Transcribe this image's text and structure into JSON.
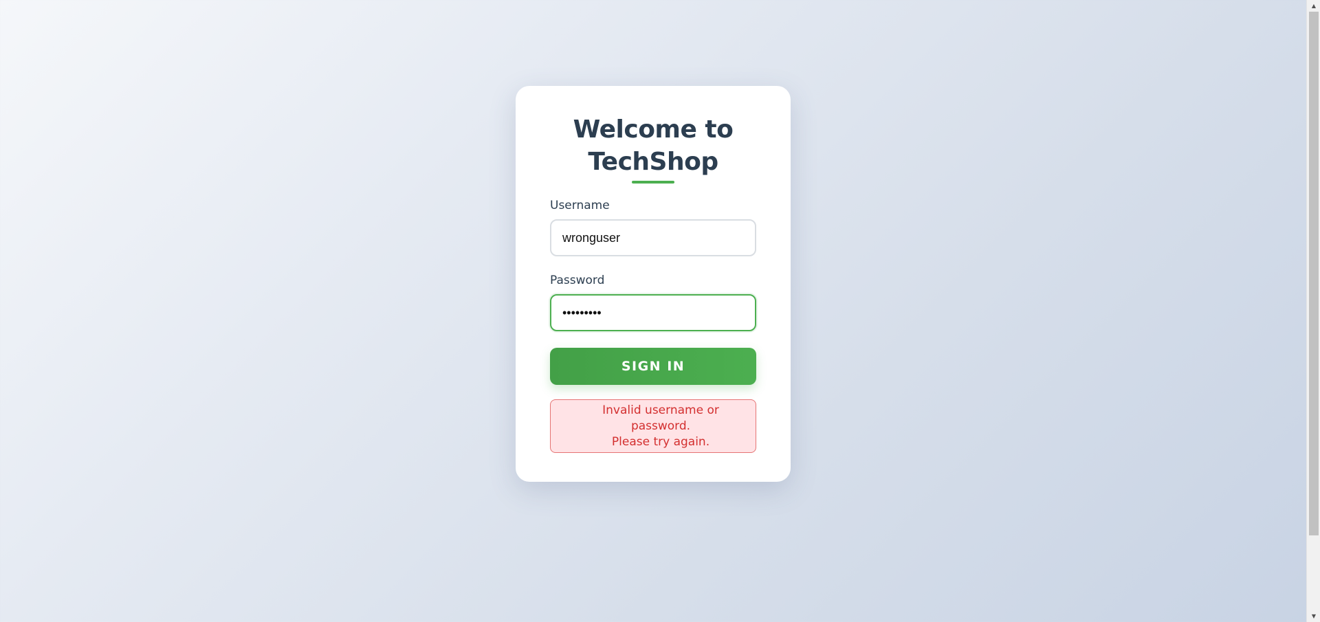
{
  "login": {
    "title_line1": "Welcome to",
    "title_line2": "TechShop",
    "username_label": "Username",
    "username_value": "wronguser",
    "password_label": "Password",
    "password_value": "•••••••••",
    "signin_label": "SIGN IN",
    "error_line1": "Invalid username or password.",
    "error_line2": "Please try again."
  },
  "colors": {
    "accent": "#4caf50",
    "title": "#2c3e50",
    "error_text": "#d32f2f",
    "error_bg": "#ffe3e6",
    "error_border": "#e57373"
  },
  "scrollbar": {
    "up_icon": "chevron-up-icon",
    "down_icon": "chevron-down-icon"
  }
}
